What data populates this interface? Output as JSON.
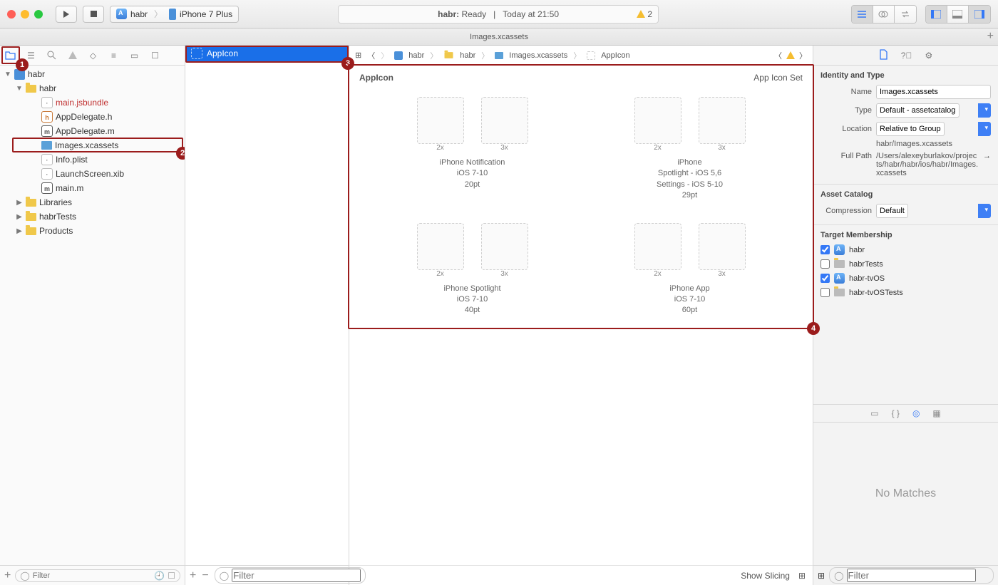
{
  "toolbar": {
    "scheme": {
      "target": "habr",
      "device": "iPhone 7 Plus"
    },
    "status": {
      "project": "habr:",
      "state": "Ready",
      "sep": "|",
      "time": "Today at 21:50",
      "warn_count": "2"
    }
  },
  "tab": {
    "title": "Images.xcassets"
  },
  "crumbs": {
    "c1": "habr",
    "c2": "habr",
    "c3": "Images.xcassets",
    "c4": "AppIcon"
  },
  "nav": {
    "root": "habr",
    "items": [
      "habr",
      "main.jsbundle",
      "AppDelegate.h",
      "AppDelegate.m",
      "Images.xcassets",
      "Info.plist",
      "LaunchScreen.xib",
      "main.m",
      "Libraries",
      "habrTests",
      "Products"
    ],
    "filter_ph": "Filter"
  },
  "list": {
    "appicon": "AppIcon",
    "filter_ph": "Filter"
  },
  "editor": {
    "title": "AppIcon",
    "type": "App Icon Set",
    "groups": [
      {
        "scales": [
          "2x",
          "3x"
        ],
        "lines": [
          "iPhone Notification",
          "iOS 7-10",
          "20pt"
        ]
      },
      {
        "scales": [
          "2x",
          "3x"
        ],
        "lines": [
          "iPhone",
          "Spotlight - iOS 5,6",
          "Settings - iOS 5-10",
          "29pt"
        ]
      },
      {
        "scales": [
          "2x",
          "3x"
        ],
        "lines": [
          "iPhone Spotlight",
          "iOS 7-10",
          "40pt"
        ]
      },
      {
        "scales": [
          "2x",
          "3x"
        ],
        "lines": [
          "iPhone App",
          "iOS 7-10",
          "60pt"
        ]
      }
    ],
    "show_slicing": "Show Slicing"
  },
  "inspector": {
    "sect1": "Identity and Type",
    "name_lbl": "Name",
    "name_val": "Images.xcassets",
    "type_lbl": "Type",
    "type_val": "Default - assetcatalog",
    "loc_lbl": "Location",
    "loc_val": "Relative to Group",
    "loc_path": "habr/Images.xcassets",
    "fp_lbl": "Full Path",
    "fp_val": "/Users/alexeyburlakov/projects/habr/habr/ios/habr/Images.xcassets",
    "sect2": "Asset Catalog",
    "comp_lbl": "Compression",
    "comp_val": "Default",
    "sect3": "Target Membership",
    "targets": [
      {
        "name": "habr",
        "checked": true,
        "icon": "app"
      },
      {
        "name": "habrTests",
        "checked": false,
        "icon": "folder"
      },
      {
        "name": "habr-tvOS",
        "checked": true,
        "icon": "app"
      },
      {
        "name": "habr-tvOSTests",
        "checked": false,
        "icon": "folder"
      }
    ],
    "no_matches": "No Matches",
    "filter_ph": "Filter"
  }
}
